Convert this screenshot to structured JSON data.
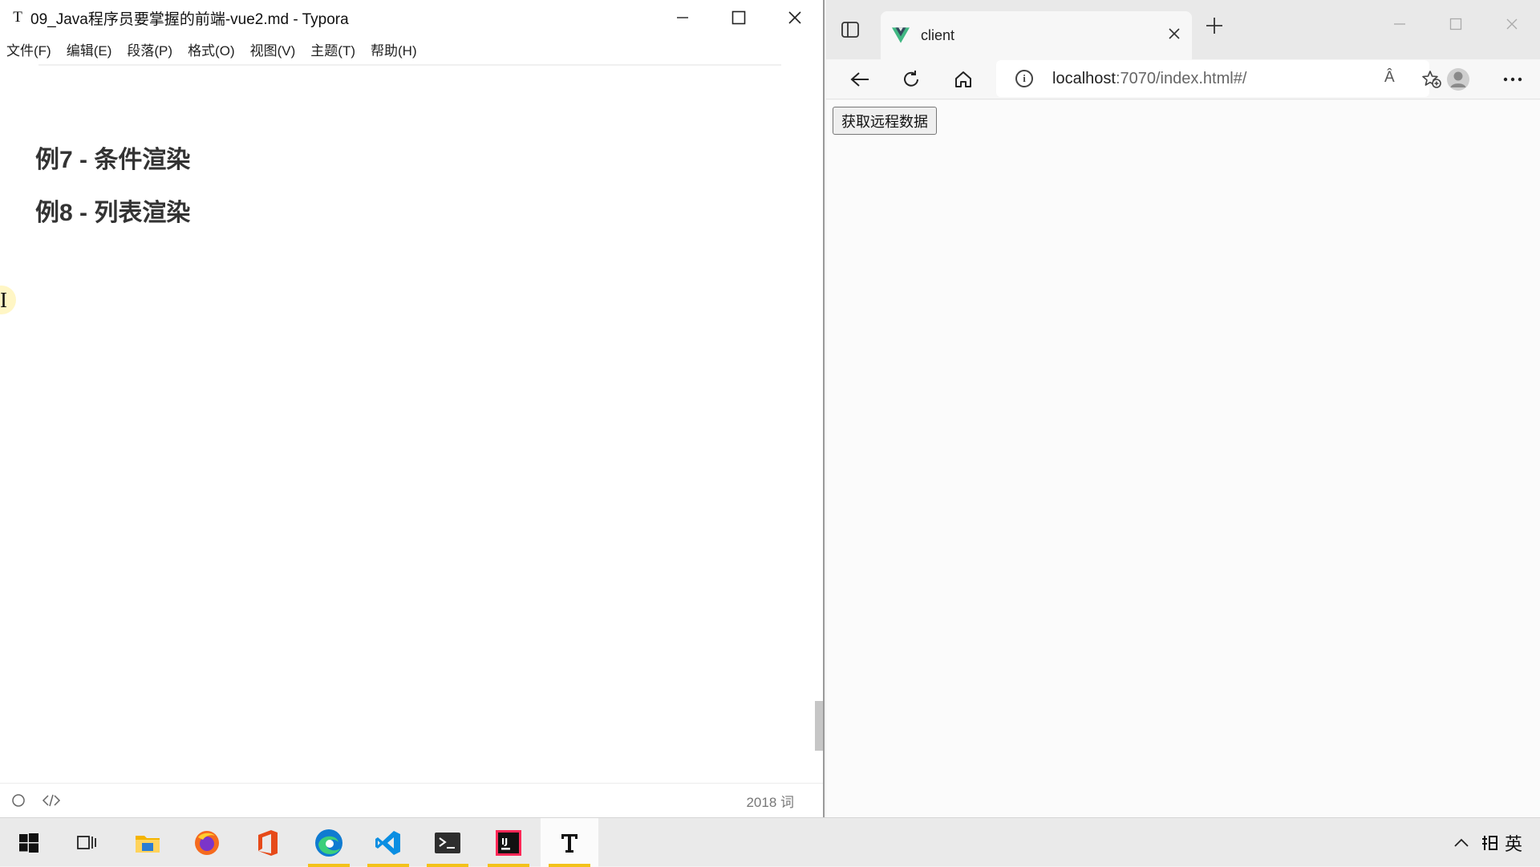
{
  "typora": {
    "app_icon": "T",
    "title": "09_Java程序员要掌握的前端-vue2.md - Typora",
    "menu": [
      "文件(F)",
      "编辑(E)",
      "段落(P)",
      "格式(O)",
      "视图(V)",
      "主题(T)",
      "帮助(H)"
    ],
    "headings": [
      "例7 - 条件渲染",
      "例8 - 列表渲染"
    ],
    "cursor_glyph": "I",
    "status": {
      "left_icons": [
        "circle-icon",
        "source-code-icon"
      ],
      "word_count": "2018 词"
    },
    "window_controls": [
      "minimize-icon",
      "maximize-icon",
      "close-icon"
    ]
  },
  "browser": {
    "tab": {
      "title": "client",
      "favicon": "vue-logo-icon"
    },
    "url_host": "localhost",
    "url_rest": ":7070/index.html#/",
    "toolbar_icons": [
      "back-icon",
      "refresh-icon",
      "home-icon",
      "read-aloud-icon",
      "favorites-add-icon",
      "profile-icon",
      "more-icon"
    ],
    "read_aloud_glyph": "Â",
    "page": {
      "button_label": "获取远程数据"
    },
    "window_controls": [
      "minimize-icon",
      "maximize-icon",
      "close-icon"
    ]
  },
  "taskbar": {
    "apps": [
      "windows-start-icon",
      "task-view-icon",
      "file-explorer-icon",
      "firefox-icon",
      "office-icon",
      "edge-icon",
      "vscode-icon",
      "terminal-icon",
      "intellij-icon",
      "typora-icon"
    ],
    "active_app": "typora-icon",
    "tray": {
      "ime_glyph": "英",
      "icons": [
        "tray-chevron-icon",
        "ime-mode-icon"
      ]
    },
    "colors": {
      "accent": "#f3c21b",
      "edge": "#0f7bd1",
      "vscode": "#0a8ee2",
      "firefox": "#f56a1e",
      "office": "#e64a19"
    }
  }
}
